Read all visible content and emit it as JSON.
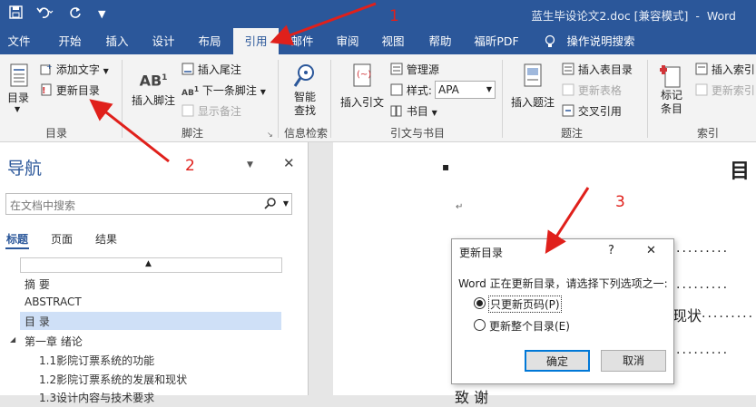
{
  "title_bar": {
    "document": "蓝生毕设论文2.doc [兼容模式]",
    "separator": "-",
    "app": "Word"
  },
  "tabs": [
    "文件",
    "开始",
    "插入",
    "设计",
    "布局",
    "引用",
    "邮件",
    "审阅",
    "视图",
    "帮助",
    "福昕PDF",
    "操作说明搜索"
  ],
  "active_tab": "引用",
  "ribbon": {
    "toc": {
      "label": "目录",
      "add_text": "添加文字",
      "update_toc": "更新目录",
      "group": "目录"
    },
    "footnote": {
      "insert_footnote": "插入脚注",
      "insert_endnote": "插入尾注",
      "next_footnote": "下一条脚注",
      "show_notes": "显示备注",
      "group": "脚注"
    },
    "research": {
      "smart_lookup": "智能查找",
      "group": "信息检索"
    },
    "citations": {
      "insert_citation": "插入引文",
      "manage_sources": "管理源",
      "style_label": "样式:",
      "style_value": "APA",
      "bibliography": "书目",
      "group": "引文与书目"
    },
    "captions": {
      "insert_caption": "插入题注",
      "insert_table_of_figures": "插入表目录",
      "update_table": "更新表格",
      "cross_reference": "交叉引用",
      "group": "题注"
    },
    "index": {
      "mark_entry": "标记条目",
      "insert_index": "插入索引",
      "update_index": "更新索引",
      "group": "索引"
    }
  },
  "nav_pane": {
    "title": "导航",
    "search_placeholder": "在文档中搜索",
    "tabs": [
      "标题",
      "页面",
      "结果"
    ],
    "items": [
      "摘 要",
      "ABSTRACT",
      "目 录",
      "第一章 绪论",
      "1.1影院订票系统的功能",
      "1.2影院订票系统的发展和现状",
      "1.3设计内容与技术要求"
    ]
  },
  "document": {
    "heading": "目",
    "text_fragment": "现状",
    "bottom_text": "致 谢",
    "bullet": "▪",
    "return_mark": "↵",
    "dots": "·········"
  },
  "dialog": {
    "title": "更新目录",
    "help": "?",
    "close": "✕",
    "message": "Word 正在更新目录，请选择下列选项之一:",
    "option1": "只更新页码(P)",
    "option2": "更新整个目录(E)",
    "selected_option": "只更新页码(P)",
    "ok": "确定",
    "cancel": "取消"
  },
  "annotations": [
    "1",
    "2",
    "3"
  ],
  "colors": {
    "brand": "#2b579a",
    "arrow": "#e0201b",
    "highlight": "#cfe0f7"
  }
}
